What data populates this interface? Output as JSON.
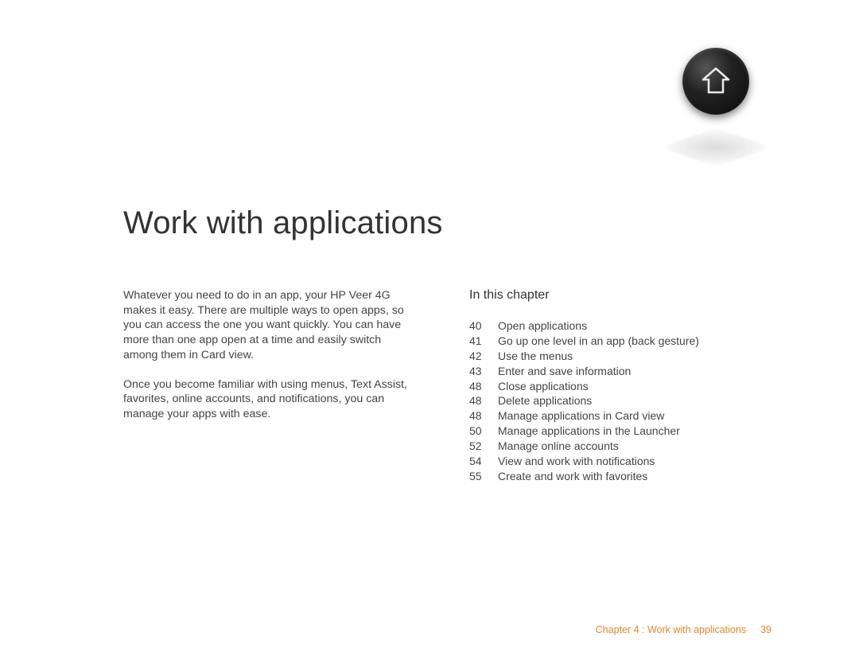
{
  "title": "Work with applications",
  "intro": {
    "p1": "Whatever you need to do in an app, your HP Veer 4G makes it easy. There are multiple ways to open apps, so you can access the one you want quickly. You can have more than one app open at a time and easily switch among them in Card view.",
    "p2": "Once you become familiar with using menus, Text Assist, favorites, online accounts, and notifications, you can manage your apps with ease."
  },
  "toc": {
    "heading": "In this chapter",
    "items": [
      {
        "page": "40",
        "label": "Open applications"
      },
      {
        "page": "41",
        "label": "Go up one level in an app (back gesture)"
      },
      {
        "page": "42",
        "label": "Use the menus"
      },
      {
        "page": "43",
        "label": "Enter and save information"
      },
      {
        "page": "48",
        "label": "Close applications"
      },
      {
        "page": "48",
        "label": "Delete applications"
      },
      {
        "page": "48",
        "label": "Manage applications in Card view"
      },
      {
        "page": "50",
        "label": "Manage applications in the Launcher"
      },
      {
        "page": "52",
        "label": "Manage online accounts"
      },
      {
        "page": "54",
        "label": "View and work with notifications"
      },
      {
        "page": "55",
        "label": "Create and work with favorites"
      }
    ]
  },
  "footer": {
    "text": "Chapter 4 : Work with applications",
    "page": "39"
  }
}
